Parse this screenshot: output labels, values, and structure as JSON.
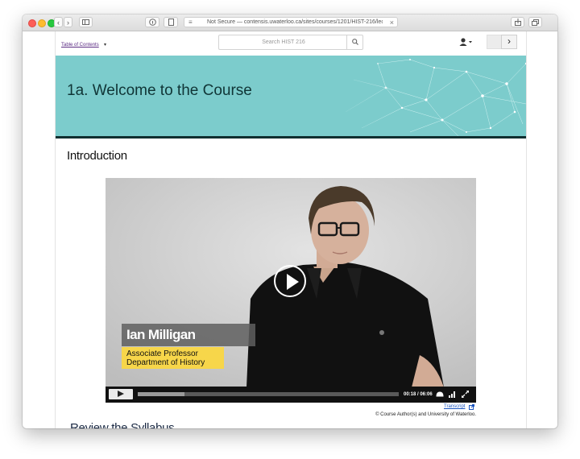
{
  "browser": {
    "url": "Not Secure — contensis.uwaterloo.ca/sites/courses/1201/HIST-216/lectu",
    "nav_back": "‹",
    "nav_forward": "›"
  },
  "header": {
    "toc_label": "Table of Contents",
    "search_placeholder": "Search HIST 216",
    "next_label": "›"
  },
  "banner": {
    "title": "1a. Welcome to the Course",
    "color": "#7ccccc"
  },
  "content": {
    "section_heading": "Introduction",
    "next_heading": "Review the Syllabus"
  },
  "video": {
    "lower_third_name": "Ian Milligan",
    "lower_third_title_line1": "Associate Professor",
    "lower_third_title_line2": "Department of History",
    "time": "00:18 / 06:06",
    "progress": 0.18,
    "transcript_label": "Transcript",
    "copyright": "© Course Author(s) and University of Waterloo."
  },
  "icons": {
    "search": "search-icon",
    "user": "user-icon",
    "play": "play-icon",
    "fullscreen": "fullscreen-icon",
    "quality": "quality-icon",
    "cc": "captions-icon"
  }
}
